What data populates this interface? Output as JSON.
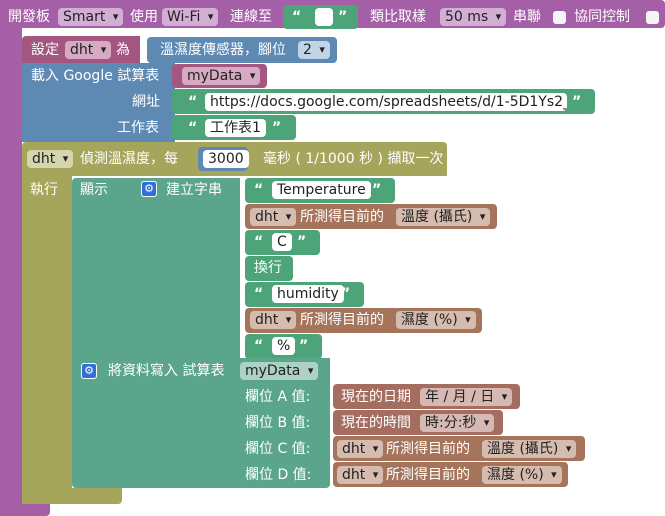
{
  "colors": {
    "board": "#a45fa7",
    "sheet": "#5d89b3",
    "var": "#a35680",
    "text": "#4ca478",
    "loop": "#a6a55c",
    "display": "#5ba58c",
    "sensor": "#a5745b",
    "time": "#a56d60"
  },
  "board": {
    "label_open": "開發板",
    "board_value": "Smart",
    "label_use": "使用",
    "net_value": "Wi-Fi",
    "label_connect": "連線至",
    "label_sample": "類比取樣",
    "sample_value": "50 ms",
    "label_serial": "串聯",
    "label_coop": "協同控制"
  },
  "setvar": {
    "label_set": "設定",
    "var_value": "dht",
    "label_as": "為",
    "label_sensor": "溫濕度傳感器，腳位",
    "pin_value": "2"
  },
  "sheet": {
    "label_load": "載入 Google 試算表",
    "sheet_var": "myData",
    "label_url": "網址",
    "url_value": "https://docs.google.com/spreadsheets/d/1-5D1Ys2_...",
    "label_worksheet": "工作表",
    "worksheet_value": "工作表1"
  },
  "loop": {
    "var_value": "dht",
    "label_detect": "偵測溫濕度，每",
    "interval_value": "3000",
    "label_ms": "毫秒 ( 1/1000 秒 ) 擷取一次",
    "label_do": "執行"
  },
  "display": {
    "label_show": "顯示",
    "label_create": "建立字串",
    "temp_text": "Temperature",
    "sensor_var": "dht",
    "label_measured": "所測得目前的",
    "temp_option": "溫度 (攝氏)",
    "c_text": "C",
    "label_newline": "換行",
    "humidity_text": "humidity",
    "humidity_option": "濕度 (%)",
    "percent_text": "%"
  },
  "write": {
    "label_write": "將資料寫入  試算表",
    "sheet_var": "myData",
    "label_a": "欄位 A 值:",
    "label_b": "欄位 B 值:",
    "label_c": "欄位 C 值:",
    "label_d": "欄位 D 值:",
    "label_date": "現在的日期",
    "date_format": "年 / 月 / 日",
    "label_time": "現在的時間",
    "time_format": "時:分:秒",
    "temp_option": "溫度 (攝氏)",
    "humidity_option": "濕度 (%)"
  }
}
